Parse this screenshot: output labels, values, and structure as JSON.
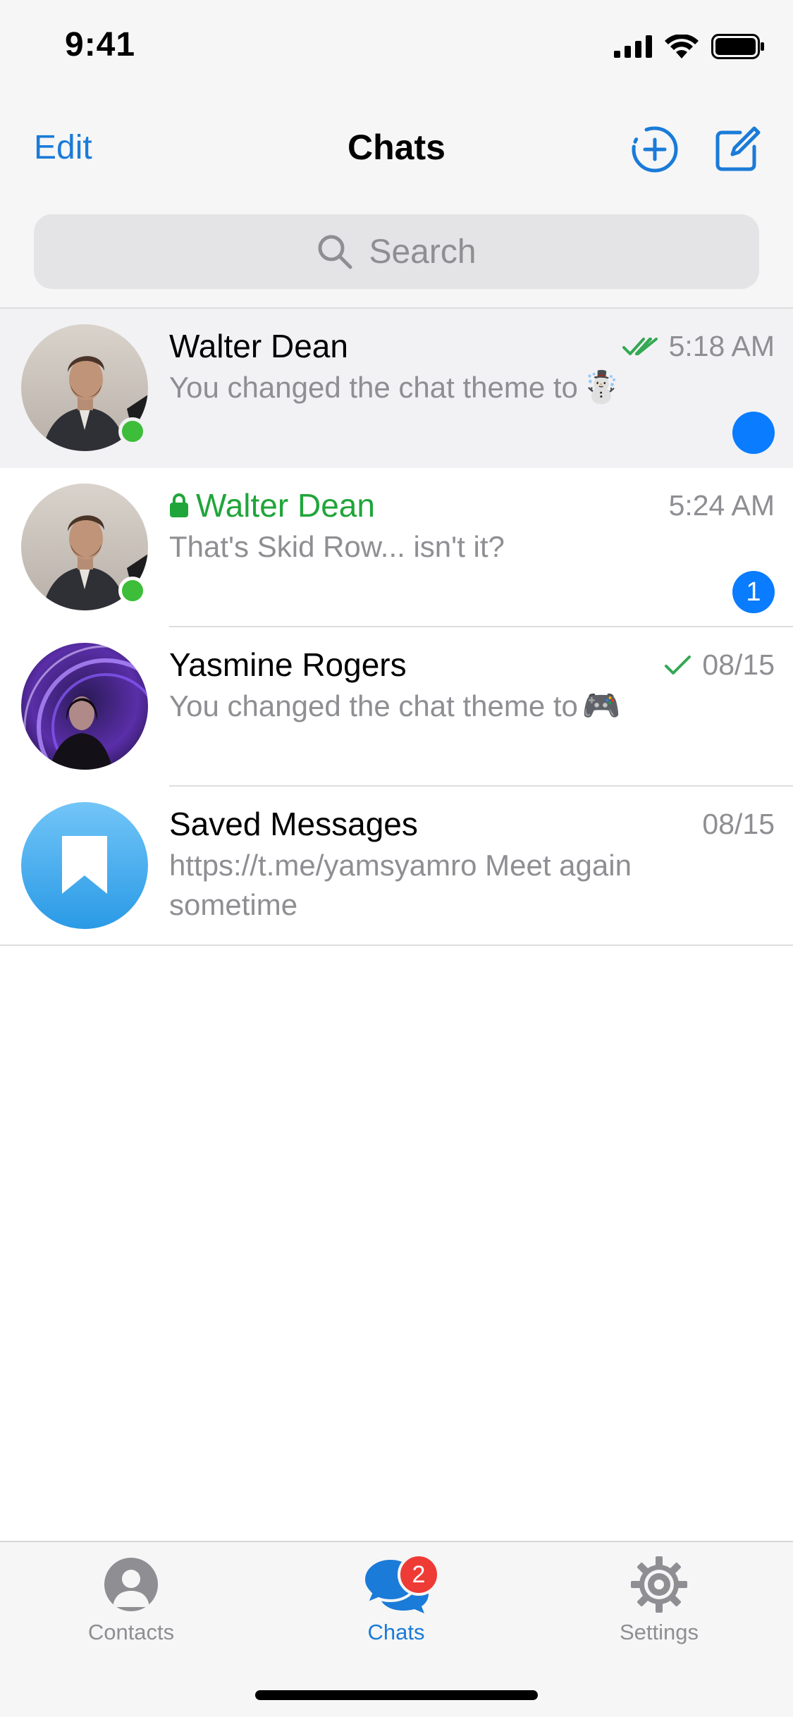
{
  "status_bar": {
    "time": "9:41"
  },
  "nav": {
    "edit_label": "Edit",
    "title": "Chats",
    "new_group_icon": "add-circle-icon",
    "compose_icon": "compose-icon"
  },
  "search": {
    "placeholder": "Search"
  },
  "chats": [
    {
      "name": "Walter Dean",
      "time": "5:18 AM",
      "preview": "You changed the chat theme to",
      "emoji": "☃️",
      "read_status": "double-check",
      "online": true,
      "unread_dot": true
    },
    {
      "name": "Walter Dean",
      "secret": true,
      "time": "5:24 AM",
      "preview": "That's Skid Row... isn't it?",
      "online": true,
      "unread_count": "1"
    },
    {
      "name": "Yasmine Rogers",
      "time": "08/15",
      "preview": "You changed the chat theme to",
      "emoji": "🎮",
      "read_status": "single-check"
    },
    {
      "name": "Saved Messages",
      "time": "08/15",
      "preview": "https://t.me/yamsyamro Meet again sometime",
      "avatar_icon": "bookmark-icon"
    }
  ],
  "tabbar": {
    "contacts_label": "Contacts",
    "chats_label": "Chats",
    "settings_label": "Settings",
    "chats_badge": "2"
  },
  "colors": {
    "accent": "#1a7bd8",
    "secret_green": "#20a53a",
    "online_green": "#3dbd39",
    "badge_blue": "#0a7cff",
    "badge_red": "#ee3b36"
  }
}
